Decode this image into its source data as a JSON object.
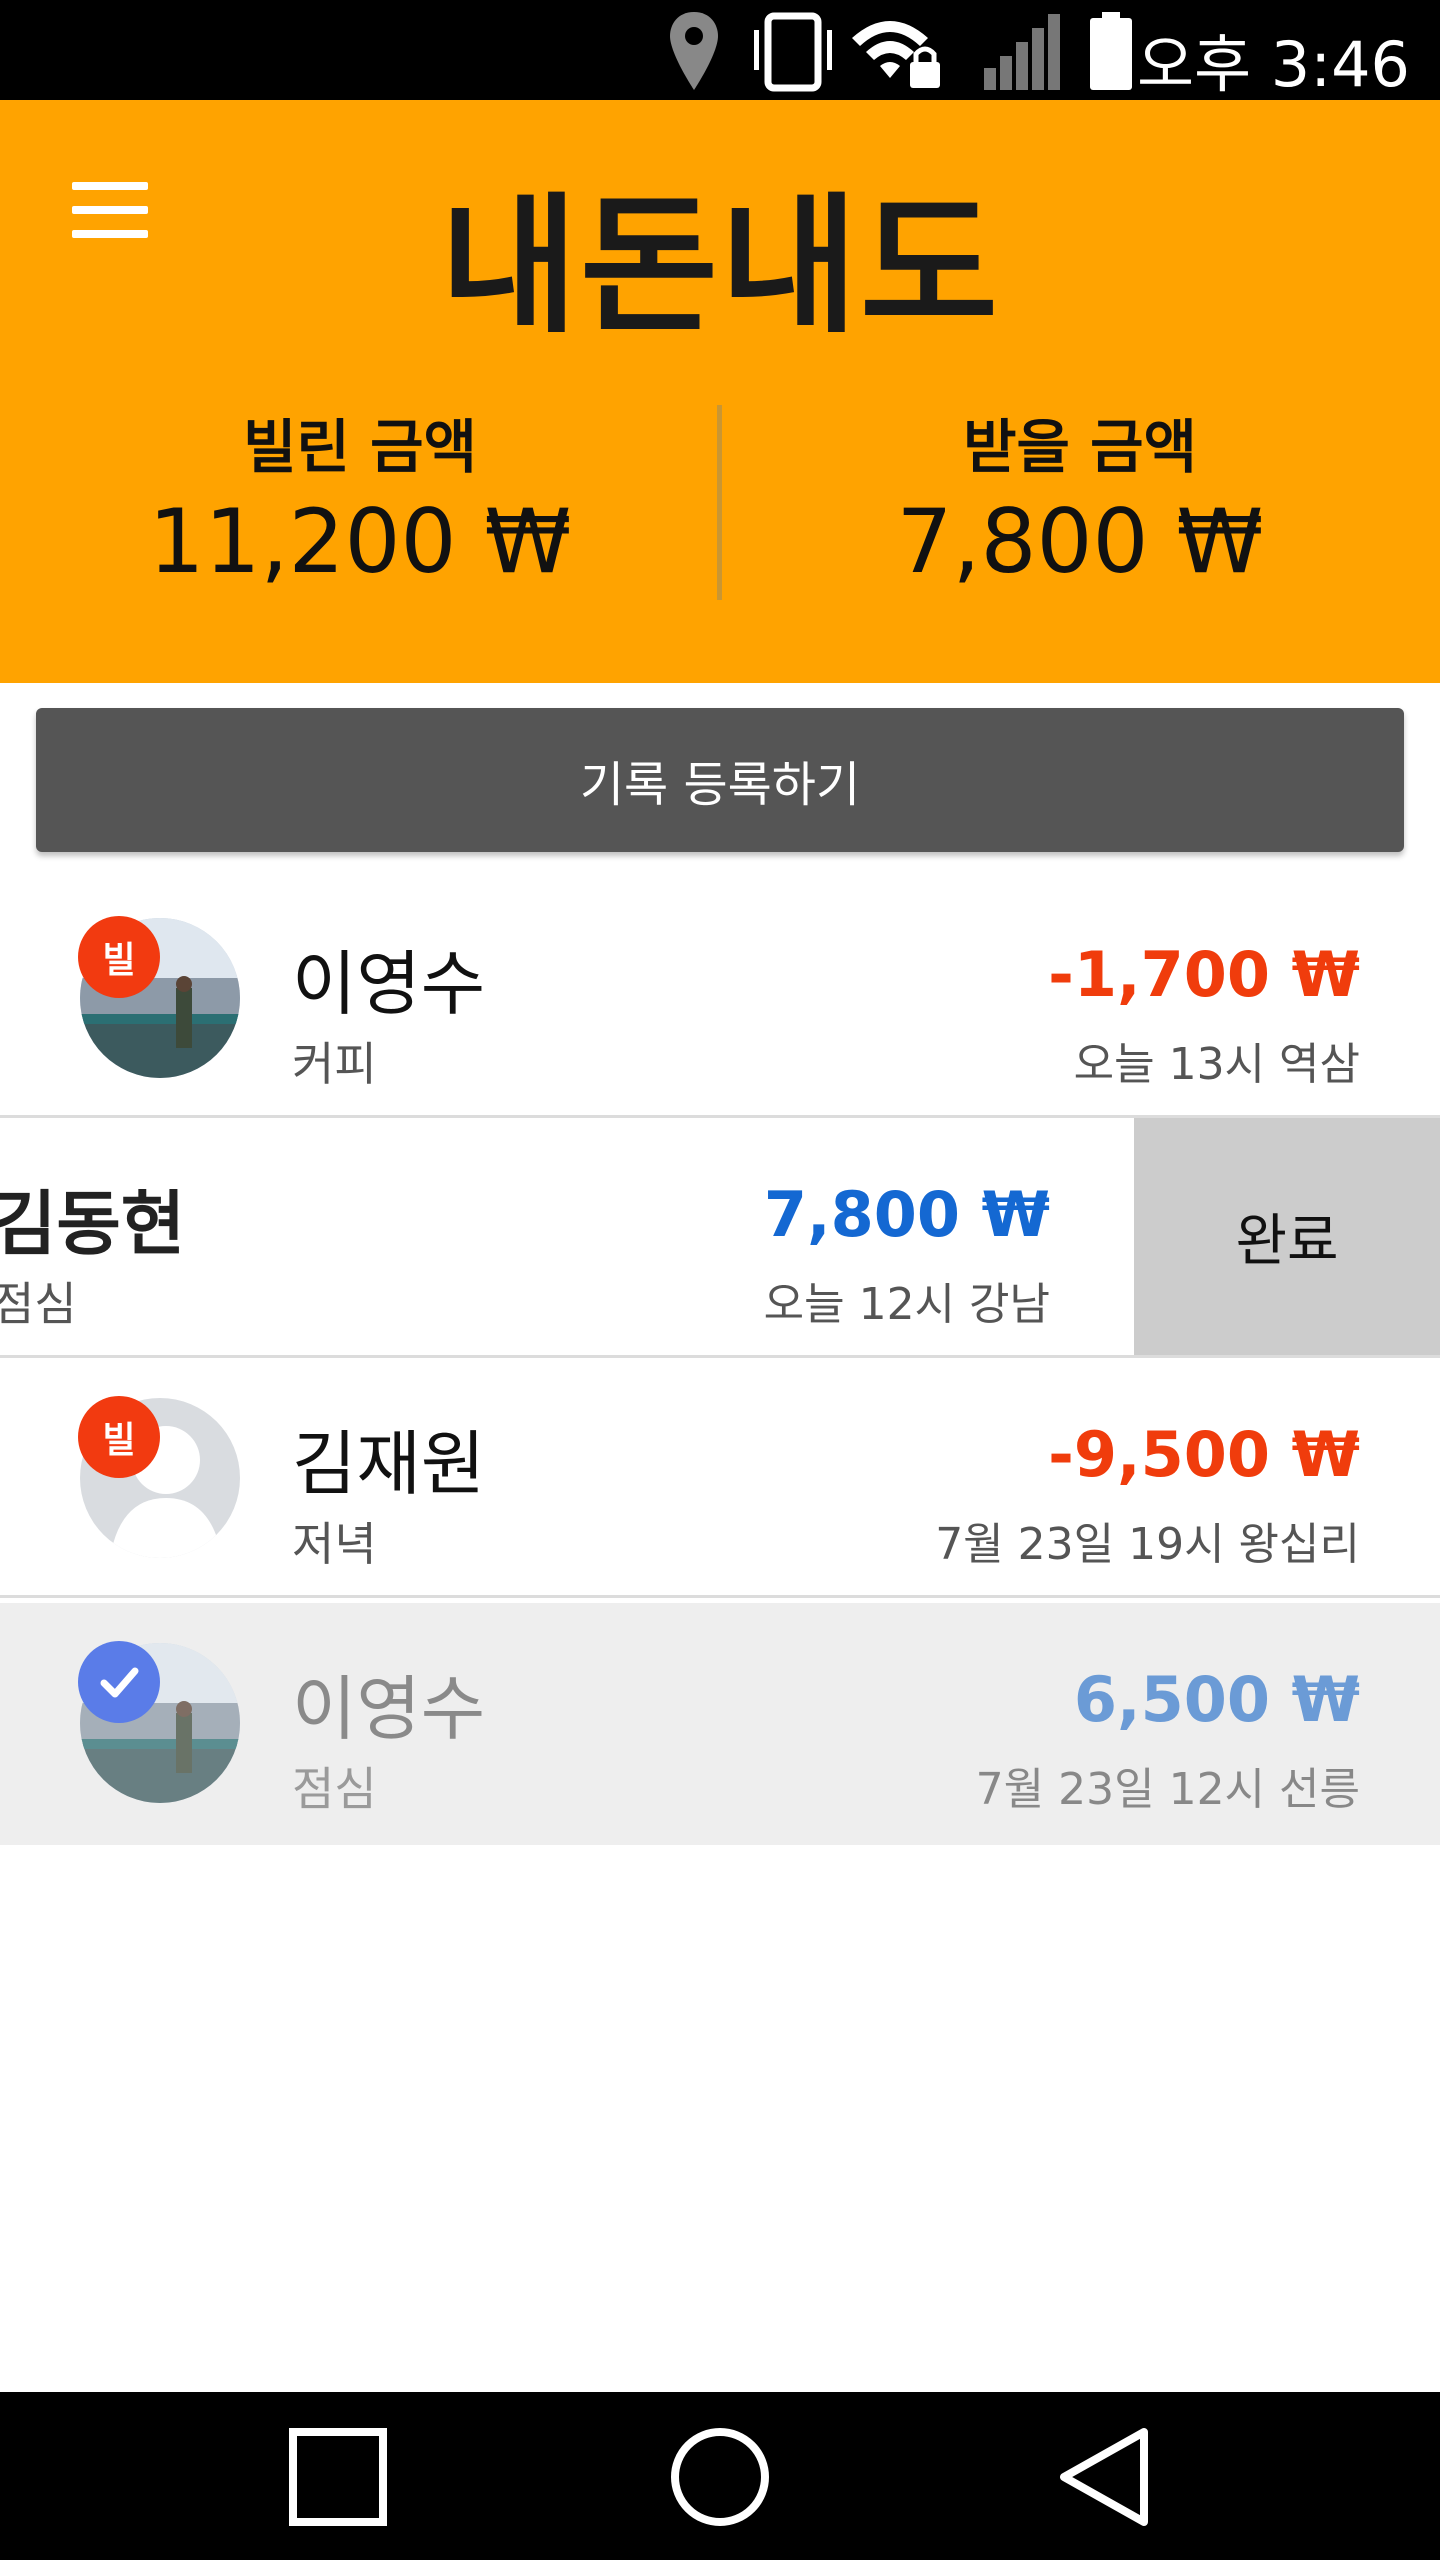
{
  "status_bar": {
    "icons": [
      "location-icon",
      "vibrate-icon",
      "wifi-lock-icon",
      "signal-icon",
      "battery-icon"
    ],
    "time": "오후 3:46"
  },
  "app_bar": {
    "title": "내돈내도",
    "color": "#ffa300",
    "borrowed": {
      "label": "빌린 금액",
      "value": "11,200 ₩"
    },
    "receivable": {
      "label": "받을 금액",
      "value": "7,800 ₩"
    }
  },
  "register_button": {
    "label": "기록 등록하기"
  },
  "records": [
    {
      "name": "이영수",
      "memo": "커피",
      "amount": "-1,700 ₩",
      "when_where": "오늘 13시 역삼",
      "badge": "빌",
      "avatar": "photo"
    },
    {
      "name": "김동현",
      "memo": "점심",
      "amount": "7,800 ₩",
      "when_where": "오늘 12시 강남",
      "action": "완료"
    },
    {
      "name": "김재원",
      "memo": "저녁",
      "amount": "-9,500 ₩",
      "when_where": "7월 23일 19시 왕십리",
      "badge": "빌",
      "avatar": "placeholder"
    },
    {
      "name": "이영수",
      "memo": "점심",
      "amount": "6,500 ₩",
      "when_where": "7월 23일 12시 선릉",
      "badge": "check",
      "avatar": "photo"
    }
  ],
  "colors": {
    "negative_amount": "#f03c0c",
    "positive_amount": "#1468d2",
    "badge_red": "#f23a10",
    "badge_check": "#5a7ce8"
  },
  "nav_bar": {
    "icons": [
      "recents-icon",
      "home-icon",
      "back-icon"
    ]
  }
}
